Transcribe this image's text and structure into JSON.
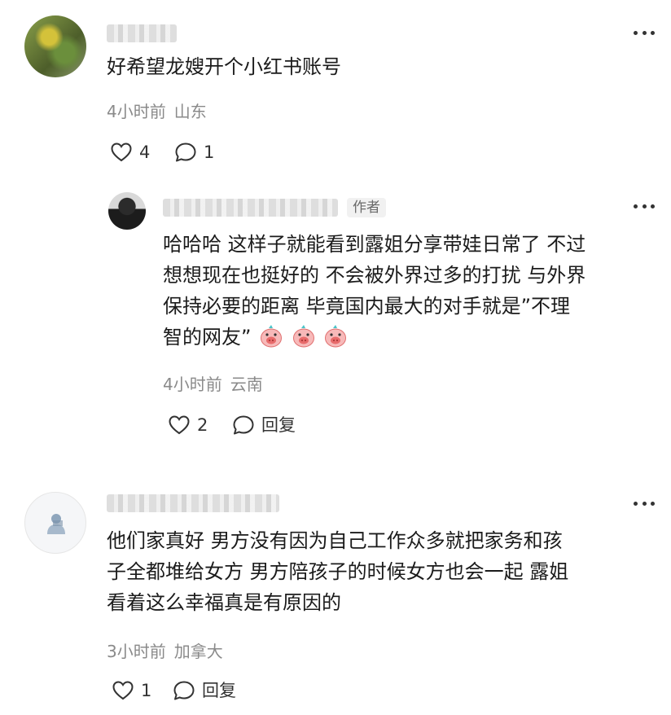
{
  "comments": [
    {
      "text": "好希望龙嫂开个小红书账号",
      "time": "4小时前",
      "location": "山东",
      "likes": "4",
      "replies": "1"
    },
    {
      "author_tag": "作者",
      "lines": [
        "哈哈哈 这样子就能看到露姐分享带娃日常了 不过",
        "想想现在也挺好的 不会被外界过多的打扰 与外界",
        "保持必要的距离 毕竟国内最大的对手就是”不理",
        "智的网友”"
      ],
      "time": "4小时前",
      "location": "云南",
      "likes": "2",
      "reply_label": "回复"
    },
    {
      "lines": [
        "他们家真好 男方没有因为自己工作众多就把家务和孩",
        "子全都堆给女方 男方陪孩子的时候女方也会一起 露姐",
        "看着这么幸福真是有原因的"
      ],
      "time": "3小时前",
      "location": "加拿大",
      "likes": "1",
      "reply_label": "回复"
    }
  ],
  "icons": {
    "heart": "heart-icon",
    "comment": "comment-bubble-icon",
    "more": "more-dots-icon",
    "emoji": "pig-face-emoji"
  }
}
